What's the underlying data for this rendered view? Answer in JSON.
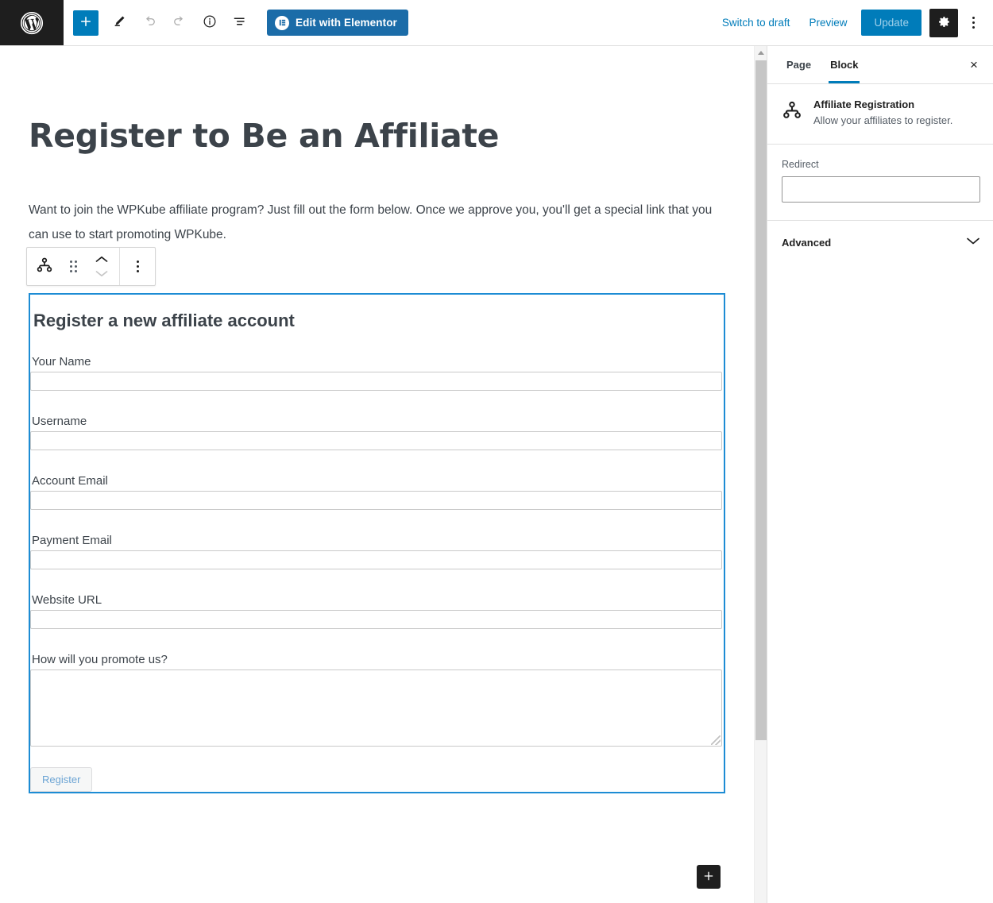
{
  "header": {
    "logo_icon": "wordpress-logo-icon",
    "tools": [
      {
        "name": "add-block-button",
        "icon": "plus-icon",
        "label": ""
      },
      {
        "name": "edit-tool-button",
        "icon": "pencil-icon",
        "label": ""
      },
      {
        "name": "undo-button",
        "icon": "undo-arrow-icon",
        "label": ""
      },
      {
        "name": "redo-button",
        "icon": "redo-arrow-icon",
        "label": ""
      },
      {
        "name": "details-button",
        "icon": "info-circle-icon",
        "label": ""
      },
      {
        "name": "list-view-button",
        "icon": "list-view-icon",
        "label": ""
      }
    ],
    "elementor_button": "Edit with Elementor",
    "switch_to_draft": "Switch to draft",
    "preview": "Preview",
    "update": "Update",
    "settings_icon": "gear-icon",
    "more_options_icon": "vertical-ellipsis-icon"
  },
  "canvas": {
    "post_title": "Register to Be an Affiliate",
    "intro_paragraph": "Want to join the WPKube affiliate program? Just fill out the form below. Once we approve you, you'll get a special link that you can use to start promoting WPKube.",
    "block_toolbar": {
      "block_icon": "affiliate-registration-icon",
      "drag_handle_icon": "drag-handle-icon",
      "move_up_icon": "chevron-up-icon",
      "move_down_icon": "chevron-down-icon",
      "options_icon": "vertical-ellipsis-icon"
    },
    "form": {
      "heading": "Register a new affiliate account",
      "fields": [
        {
          "label": "Your Name",
          "type": "text",
          "value": "",
          "name": "your-name"
        },
        {
          "label": "Username",
          "type": "text",
          "value": "",
          "name": "username"
        },
        {
          "label": "Account Email",
          "type": "text",
          "value": "",
          "name": "account-email"
        },
        {
          "label": "Payment Email",
          "type": "text",
          "value": "",
          "name": "payment-email"
        },
        {
          "label": "Website URL",
          "type": "text",
          "value": "",
          "name": "website-url"
        },
        {
          "label": "How will you promote us?",
          "type": "textarea",
          "value": "",
          "name": "promotion-method"
        }
      ],
      "submit_label": "Register"
    },
    "bottom_inserter_icon": "plus-icon"
  },
  "sidebar": {
    "tabs": [
      {
        "label": "Page",
        "active": false
      },
      {
        "label": "Block",
        "active": true
      }
    ],
    "close_label": "×",
    "block_card": {
      "icon": "affiliate-registration-icon",
      "title": "Affiliate Registration",
      "description": "Allow your affiliates to register."
    },
    "redirect": {
      "label": "Redirect",
      "value": "",
      "placeholder": ""
    },
    "advanced": {
      "label": "Advanced",
      "chevron_icon": "chevron-down-icon"
    }
  },
  "colors": {
    "wp_blue": "#007cba",
    "selection_blue": "#1d8cd4",
    "elementor_blue": "#1b6ca8",
    "dark": "#1e1e1e",
    "text": "#3c434a"
  }
}
